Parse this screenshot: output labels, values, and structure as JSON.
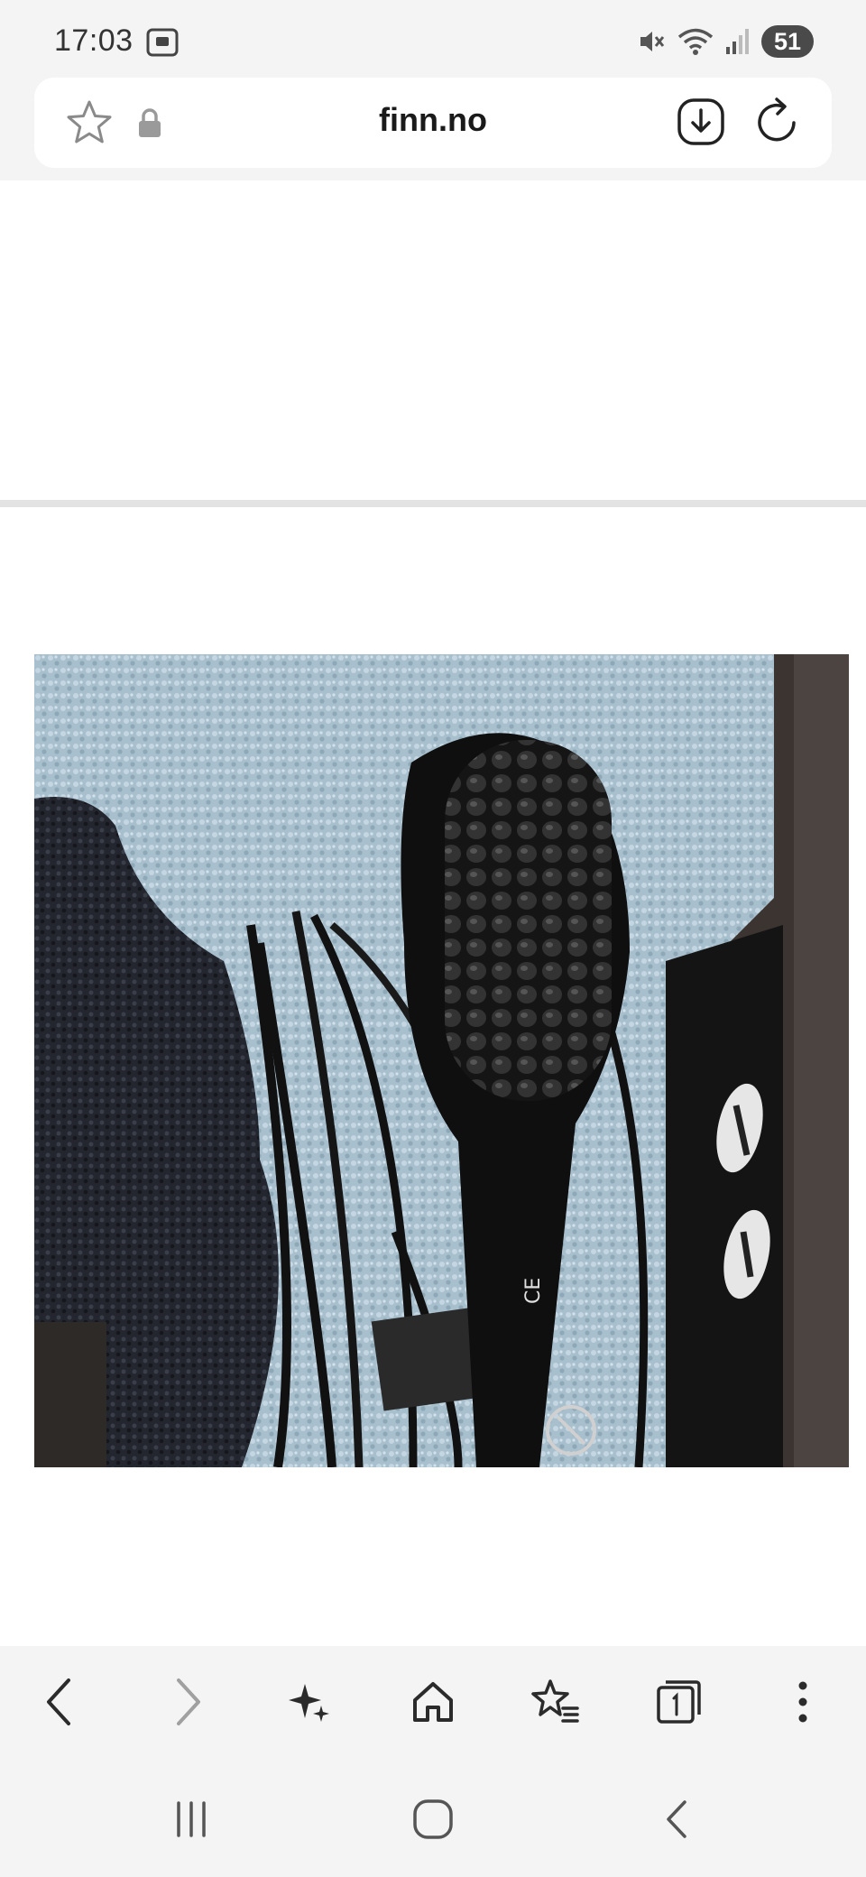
{
  "status_bar": {
    "time": "17:03",
    "battery_level": "51"
  },
  "browser": {
    "url": "finn.no"
  },
  "listing": {
    "photo_description_icon": "hair-straightening-brush-photo"
  },
  "colors": {
    "chrome_background": "#f4f4f4",
    "url_bar_background": "#ffffff",
    "divider": "#e3e3e3",
    "battery_badge": "#4a4a4a"
  }
}
